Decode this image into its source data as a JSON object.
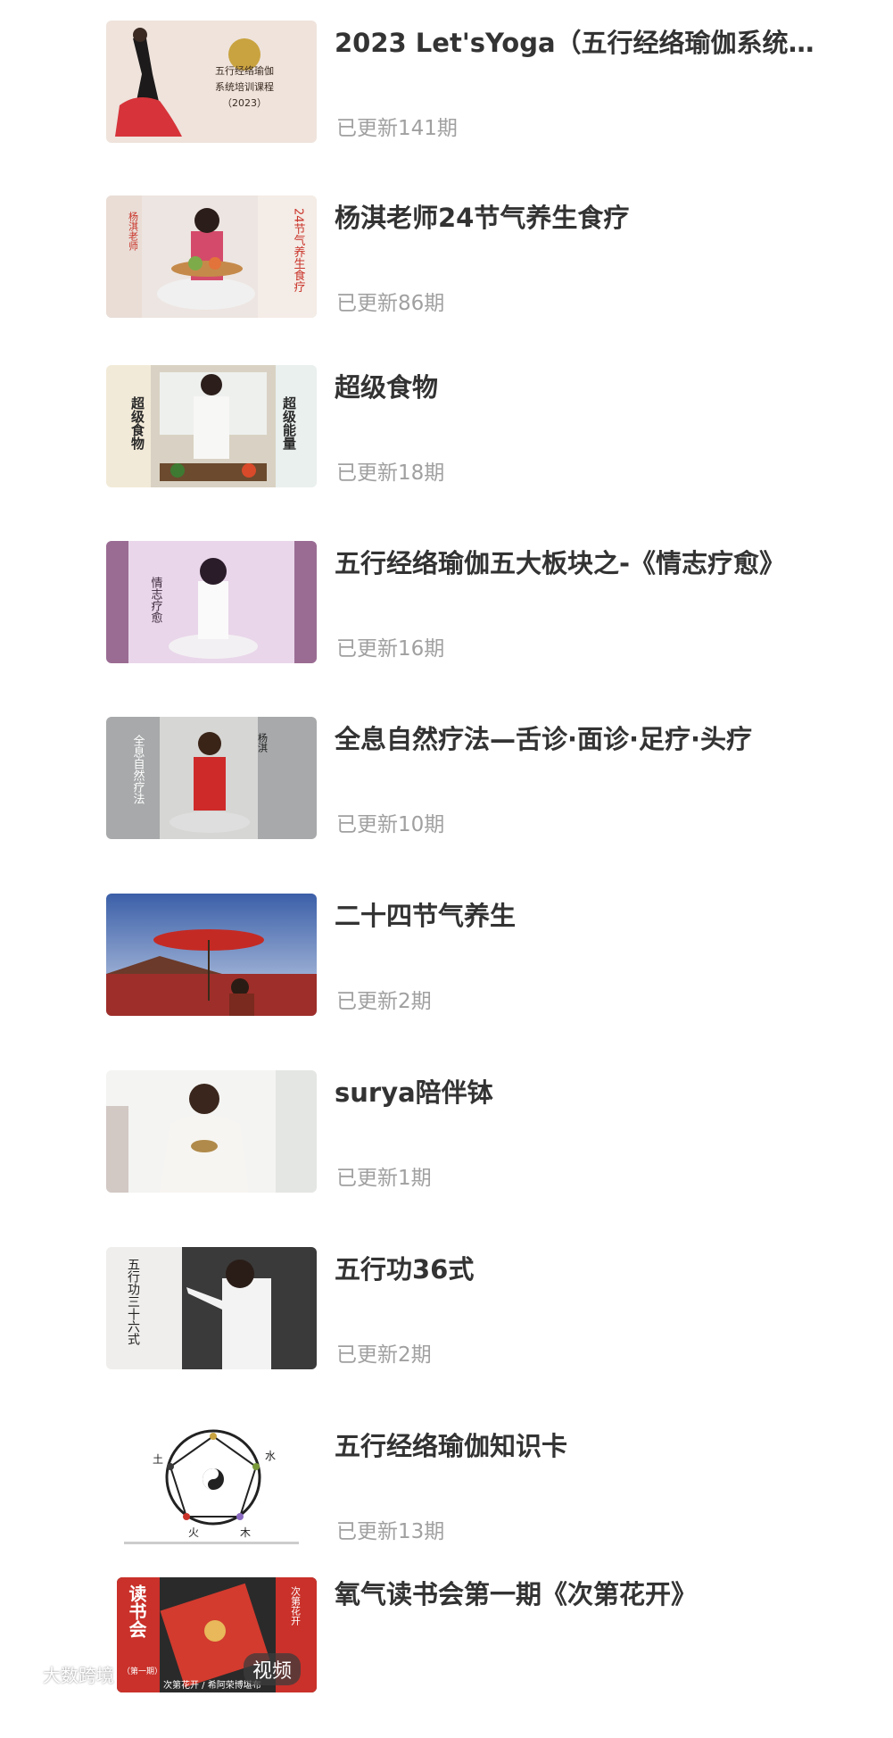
{
  "courses": [
    {
      "title": "2023 Let'sYoga（五行经络瑜伽系统培…",
      "meta": "已更新141期",
      "thumb": "yoga-2023-cover"
    },
    {
      "title": "杨淇老师24节气养生食疗",
      "meta": "已更新86期",
      "thumb": "solar-terms-food-cover"
    },
    {
      "title": "超级食物",
      "meta": "已更新18期",
      "thumb": "super-food-cover"
    },
    {
      "title": "五行经络瑜伽五大板块之-《情志疗愈》",
      "meta": "已更新16期",
      "thumb": "emotion-healing-cover"
    },
    {
      "title": "全息自然疗法—舌诊·面诊·足疗·头疗",
      "meta": "已更新10期",
      "thumb": "holistic-therapy-cover"
    },
    {
      "title": "二十四节气养生",
      "meta": "已更新2期",
      "thumb": "twenty-four-solar-terms-cover"
    },
    {
      "title": "surya陪伴钵",
      "meta": "已更新1期",
      "thumb": "singing-bowl-cover"
    },
    {
      "title": "五行功36式",
      "meta": "已更新2期",
      "thumb": "wuxing-36-cover"
    },
    {
      "title": "五行经络瑜伽知识卡",
      "meta": "已更新13期",
      "thumb": "five-elements-card-cover"
    },
    {
      "title": "氧气读书会第一期《次第花开》",
      "meta": "",
      "thumb": "book-club-cover",
      "badge": "视频"
    }
  ],
  "thumb_text": {
    "c0": [
      "五行经络瑜伽",
      "系统培训课程",
      "（2023）"
    ],
    "c1_left": "杨淇老师",
    "c1_right": "24节气养生食疗",
    "c2_left": "超级食物",
    "c2_right": "超级能量",
    "c3_mid": "情志疗愈",
    "c4_left": "全息自然疗法",
    "c4_right": "杨淇",
    "c7_left": "五行功三十六式",
    "c8_top_left": "土",
    "c8_top_right": "水",
    "c8_bottom_left": "火",
    "c8_bottom_right": "木",
    "c9_left": "读书会",
    "c9_left_sub": "（第一期）",
    "c9_right": "次第花开",
    "c9_bottom": "次第花开 / 希阿荣博堪布"
  },
  "watermark": "大数跨境",
  "colors": {
    "title": "#333333",
    "meta": "#a0a0a0",
    "background": "#ffffff"
  }
}
